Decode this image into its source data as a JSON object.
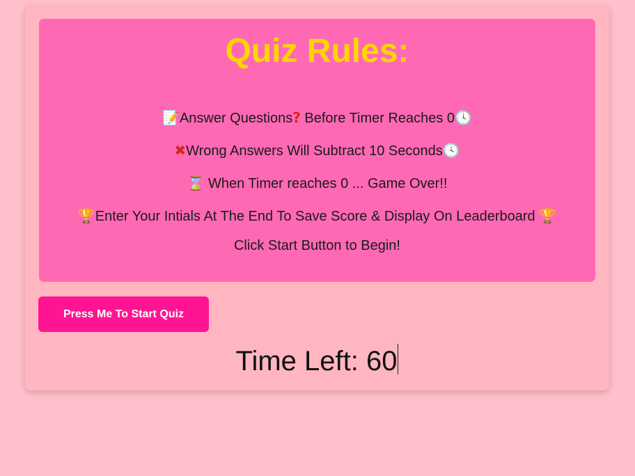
{
  "rules": {
    "title": "Quiz Rules:",
    "line1": {
      "pre_icon": "memo-icon",
      "text_a": "Answer Questions",
      "mid_icon": "question-mark-icon",
      "text_b": " Before Timer Reaches 0",
      "post_icon": "clock-icon"
    },
    "line2": {
      "pre_icon": "cross-mark-icon",
      "text": "Wrong Answers Will Subtract 10 Seconds",
      "post_icon": "clock-icon"
    },
    "line3": {
      "pre_icon": "hourglass-icon",
      "text": " When Timer reaches 0 ... Game Over!!"
    },
    "line4": {
      "pre_icon": "trophy-icon",
      "text": "Enter Your Intials At The End To Save Score & Display On Leaderboard ",
      "post_icon": "trophy-icon"
    },
    "line5": {
      "text": "Click Start Button to Begin!"
    }
  },
  "start_button": {
    "label": "Press Me To Start Quiz"
  },
  "timer": {
    "label": "Time Left: ",
    "value": "60"
  },
  "colors": {
    "page_background": "#ffc0cb",
    "card_background": "#ffb6c1",
    "rules_background": "#ff69b4",
    "title_color": "#ffd700",
    "button_background": "#ff1493",
    "button_text": "#ffffff"
  }
}
